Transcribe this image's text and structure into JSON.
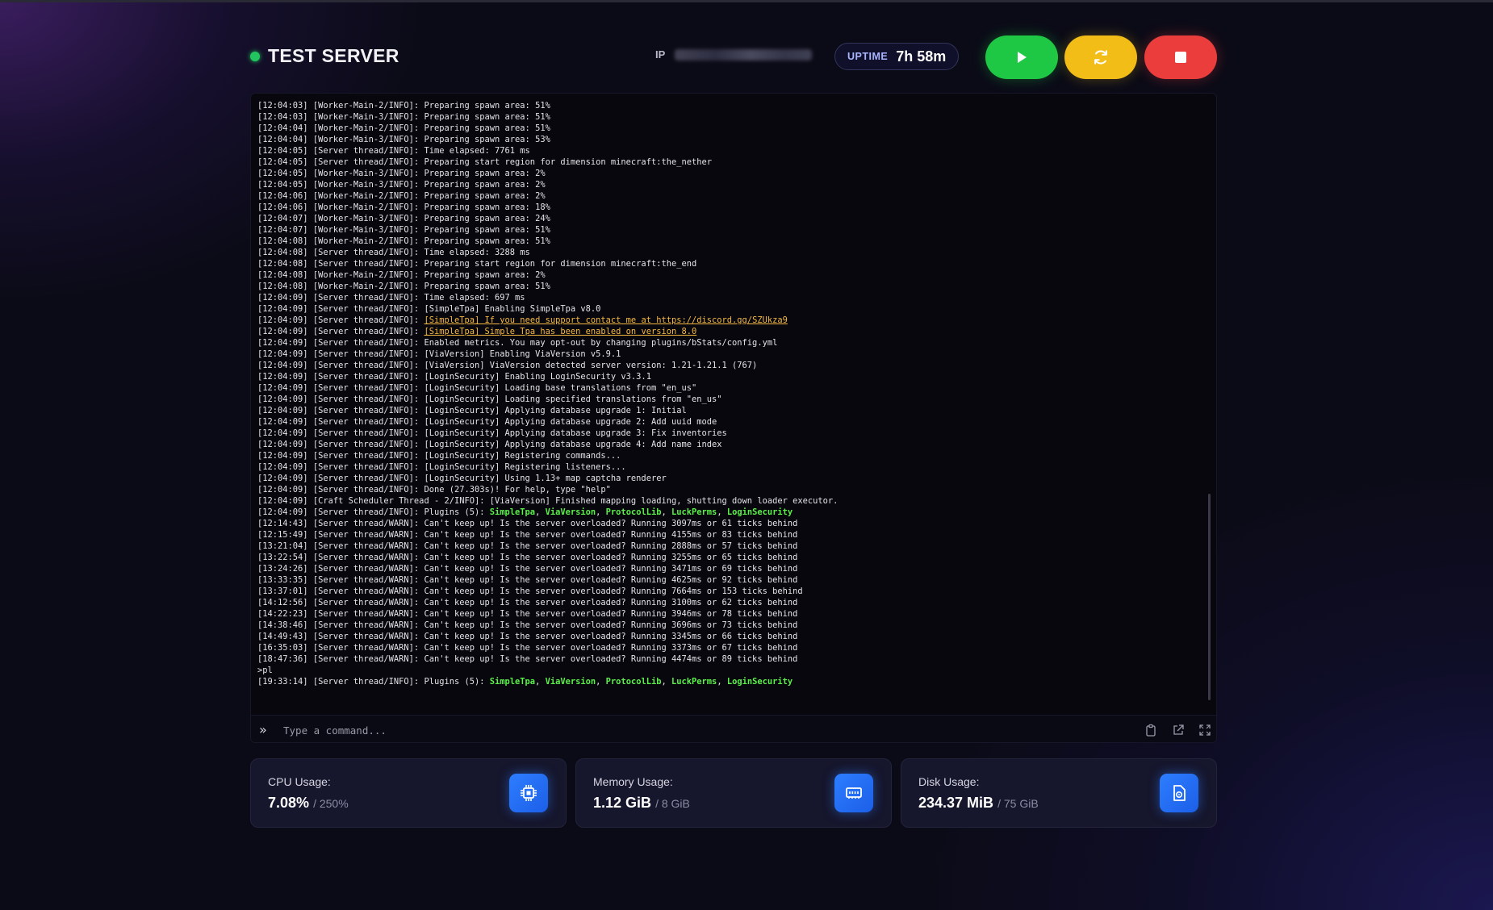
{
  "header": {
    "server_name": "TEST SERVER",
    "ip_label": "IP",
    "uptime_label": "UPTIME",
    "uptime_value": "7h 58m"
  },
  "controls": {
    "start_icon": "play-icon",
    "restart_icon": "refresh-icon",
    "stop_icon": "stop-icon"
  },
  "colors": {
    "status_online": "#22c55e",
    "start": "#1fc844",
    "restart": "#f2bd17",
    "stop": "#ec3d3d",
    "accent": "#2d7dff",
    "log_link": "#f5b942",
    "log_plugin": "#5cf04a"
  },
  "console": {
    "prompt_icon": "chevron-double-right-icon",
    "placeholder": "Type a command...",
    "tools": [
      "clipboard-icon",
      "external-link-icon",
      "fullscreen-icon"
    ],
    "lines": [
      [
        {
          "t": "[12:04:03] [Worker-Main-2/INFO]: Preparing spawn area: 51%"
        }
      ],
      [
        {
          "t": "[12:04:03] [Worker-Main-3/INFO]: Preparing spawn area: 51%"
        }
      ],
      [
        {
          "t": "[12:04:04] [Worker-Main-2/INFO]: Preparing spawn area: 51%"
        }
      ],
      [
        {
          "t": "[12:04:04] [Worker-Main-3/INFO]: Preparing spawn area: 53%"
        }
      ],
      [
        {
          "t": "[12:04:05] [Server thread/INFO]: Time elapsed: 7761 ms"
        }
      ],
      [
        {
          "t": "[12:04:05] [Server thread/INFO]: Preparing start region for dimension minecraft:the_nether"
        }
      ],
      [
        {
          "t": "[12:04:05] [Worker-Main-3/INFO]: Preparing spawn area: 2%"
        }
      ],
      [
        {
          "t": "[12:04:05] [Worker-Main-3/INFO]: Preparing spawn area: 2%"
        }
      ],
      [
        {
          "t": "[12:04:06] [Worker-Main-2/INFO]: Preparing spawn area: 2%"
        }
      ],
      [
        {
          "t": "[12:04:06] [Worker-Main-2/INFO]: Preparing spawn area: 18%"
        }
      ],
      [
        {
          "t": "[12:04:07] [Worker-Main-3/INFO]: Preparing spawn area: 24%"
        }
      ],
      [
        {
          "t": "[12:04:07] [Worker-Main-3/INFO]: Preparing spawn area: 51%"
        }
      ],
      [
        {
          "t": "[12:04:08] [Worker-Main-2/INFO]: Preparing spawn area: 51%"
        }
      ],
      [
        {
          "t": "[12:04:08] [Server thread/INFO]: Time elapsed: 3288 ms"
        }
      ],
      [
        {
          "t": "[12:04:08] [Server thread/INFO]: Preparing start region for dimension minecraft:the_end"
        }
      ],
      [
        {
          "t": "[12:04:08] [Worker-Main-2/INFO]: Preparing spawn area: 2%"
        }
      ],
      [
        {
          "t": "[12:04:08] [Worker-Main-2/INFO]: Preparing spawn area: 51%"
        }
      ],
      [
        {
          "t": "[12:04:09] [Server thread/INFO]: Time elapsed: 697 ms"
        }
      ],
      [
        {
          "t": "[12:04:09] [Server thread/INFO]: [SimpleTpa] Enabling SimpleTpa v8.0"
        }
      ],
      [
        {
          "t": "[12:04:09] [Server thread/INFO]: "
        },
        {
          "t": "[SimpleTpa] If you need support contact me at https://discord.gg/SZUkza9",
          "c": "hl-yellow"
        }
      ],
      [
        {
          "t": "[12:04:09] [Server thread/INFO]: "
        },
        {
          "t": "[SimpleTpa] Simple Tpa has been enabled on version 8.0",
          "c": "hl-yellow"
        }
      ],
      [
        {
          "t": "[12:04:09] [Server thread/INFO]: Enabled metrics. You may opt-out by changing plugins/bStats/config.yml"
        }
      ],
      [
        {
          "t": "[12:04:09] [Server thread/INFO]: [ViaVersion] Enabling ViaVersion v5.9.1"
        }
      ],
      [
        {
          "t": "[12:04:09] [Server thread/INFO]: [ViaVersion] ViaVersion detected server version: 1.21-1.21.1 (767)"
        }
      ],
      [
        {
          "t": "[12:04:09] [Server thread/INFO]: [LoginSecurity] Enabling LoginSecurity v3.3.1"
        }
      ],
      [
        {
          "t": "[12:04:09] [Server thread/INFO]: [LoginSecurity] Loading base translations from \"en_us\""
        }
      ],
      [
        {
          "t": "[12:04:09] [Server thread/INFO]: [LoginSecurity] Loading specified translations from \"en_us\""
        }
      ],
      [
        {
          "t": "[12:04:09] [Server thread/INFO]: [LoginSecurity] Applying database upgrade 1: Initial"
        }
      ],
      [
        {
          "t": "[12:04:09] [Server thread/INFO]: [LoginSecurity] Applying database upgrade 2: Add uuid mode"
        }
      ],
      [
        {
          "t": "[12:04:09] [Server thread/INFO]: [LoginSecurity] Applying database upgrade 3: Fix inventories"
        }
      ],
      [
        {
          "t": "[12:04:09] [Server thread/INFO]: [LoginSecurity] Applying database upgrade 4: Add name index"
        }
      ],
      [
        {
          "t": "[12:04:09] [Server thread/INFO]: [LoginSecurity] Registering commands..."
        }
      ],
      [
        {
          "t": "[12:04:09] [Server thread/INFO]: [LoginSecurity] Registering listeners..."
        }
      ],
      [
        {
          "t": "[12:04:09] [Server thread/INFO]: [LoginSecurity] Using 1.13+ map captcha renderer"
        }
      ],
      [
        {
          "t": "[12:04:09] [Server thread/INFO]: Done (27.303s)! For help, type \"help\""
        }
      ],
      [
        {
          "t": "[12:04:09] [Craft Scheduler Thread - 2/INFO]: [ViaVersion] Finished mapping loading, shutting down loader executor."
        }
      ],
      [
        {
          "t": "[12:04:09] [Server thread/INFO]: Plugins (5): "
        },
        {
          "t": "SimpleTpa",
          "c": "hl-green"
        },
        {
          "t": ", "
        },
        {
          "t": "ViaVersion",
          "c": "hl-green"
        },
        {
          "t": ", "
        },
        {
          "t": "ProtocolLib",
          "c": "hl-green"
        },
        {
          "t": ", "
        },
        {
          "t": "LuckPerms",
          "c": "hl-green"
        },
        {
          "t": ", "
        },
        {
          "t": "LoginSecurity",
          "c": "hl-green"
        }
      ],
      [
        {
          "t": "[12:14:43] [Server thread/WARN]: Can't keep up! Is the server overloaded? Running 3097ms or 61 ticks behind"
        }
      ],
      [
        {
          "t": "[12:15:49] [Server thread/WARN]: Can't keep up! Is the server overloaded? Running 4155ms or 83 ticks behind"
        }
      ],
      [
        {
          "t": "[13:21:04] [Server thread/WARN]: Can't keep up! Is the server overloaded? Running 2888ms or 57 ticks behind"
        }
      ],
      [
        {
          "t": "[13:22:54] [Server thread/WARN]: Can't keep up! Is the server overloaded? Running 3255ms or 65 ticks behind"
        }
      ],
      [
        {
          "t": "[13:24:26] [Server thread/WARN]: Can't keep up! Is the server overloaded? Running 3471ms or 69 ticks behind"
        }
      ],
      [
        {
          "t": "[13:33:35] [Server thread/WARN]: Can't keep up! Is the server overloaded? Running 4625ms or 92 ticks behind"
        }
      ],
      [
        {
          "t": "[13:37:01] [Server thread/WARN]: Can't keep up! Is the server overloaded? Running 7664ms or 153 ticks behind"
        }
      ],
      [
        {
          "t": "[14:12:56] [Server thread/WARN]: Can't keep up! Is the server overloaded? Running 3100ms or 62 ticks behind"
        }
      ],
      [
        {
          "t": "[14:22:23] [Server thread/WARN]: Can't keep up! Is the server overloaded? Running 3946ms or 78 ticks behind"
        }
      ],
      [
        {
          "t": "[14:38:46] [Server thread/WARN]: Can't keep up! Is the server overloaded? Running 3696ms or 73 ticks behind"
        }
      ],
      [
        {
          "t": "[14:49:43] [Server thread/WARN]: Can't keep up! Is the server overloaded? Running 3345ms or 66 ticks behind"
        }
      ],
      [
        {
          "t": "[16:35:03] [Server thread/WARN]: Can't keep up! Is the server overloaded? Running 3373ms or 67 ticks behind"
        }
      ],
      [
        {
          "t": "[18:47:36] [Server thread/WARN]: Can't keep up! Is the server overloaded? Running 4474ms or 89 ticks behind"
        }
      ],
      [
        {
          "t": ">pl"
        }
      ],
      [
        {
          "t": "[19:33:14] [Server thread/INFO]: Plugins (5): "
        },
        {
          "t": "SimpleTpa",
          "c": "hl-green"
        },
        {
          "t": ", "
        },
        {
          "t": "ViaVersion",
          "c": "hl-green"
        },
        {
          "t": ", "
        },
        {
          "t": "ProtocolLib",
          "c": "hl-green"
        },
        {
          "t": ", "
        },
        {
          "t": "LuckPerms",
          "c": "hl-green"
        },
        {
          "t": ", "
        },
        {
          "t": "LoginSecurity",
          "c": "hl-green"
        }
      ]
    ]
  },
  "stats": {
    "cpu": {
      "label": "CPU Usage:",
      "value": "7.08%",
      "max": "/ 250%",
      "icon": "cpu-icon"
    },
    "memory": {
      "label": "Memory Usage:",
      "value": "1.12 GiB",
      "max": "/ 8 GiB",
      "icon": "memory-icon"
    },
    "disk": {
      "label": "Disk Usage:",
      "value": "234.37 MiB",
      "max": "/ 75 GiB",
      "icon": "disk-icon"
    }
  }
}
